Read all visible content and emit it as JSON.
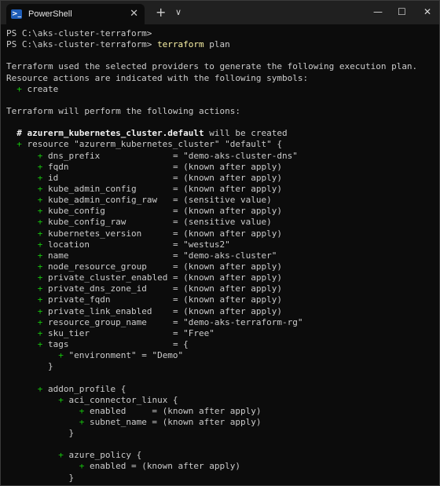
{
  "window": {
    "tab_title": "PowerShell",
    "tab_icon": "powershell-icon",
    "close_tab_glyph": "✕",
    "new_tab_glyph": "+",
    "dropdown_glyph": "∨",
    "minimize_glyph": "—",
    "maximize_glyph": "☐",
    "close_glyph": "✕"
  },
  "colors": {
    "background": "#0c0c0c",
    "text": "#cccccc",
    "command": "#f9f1a5",
    "plus": "#16c60c",
    "bold": "#f2f2f2"
  },
  "terminal": {
    "lines": [
      [
        {
          "t": "PS C:\\aks-cluster-terraform>"
        }
      ],
      [
        {
          "t": "PS C:\\aks-cluster-terraform> "
        },
        {
          "t": "terraform",
          "c": "cmd"
        },
        {
          "t": " plan"
        }
      ],
      [],
      [
        {
          "t": "Terraform used the selected providers to generate the following execution plan."
        }
      ],
      [
        {
          "t": "Resource actions are indicated with the following symbols:"
        }
      ],
      [
        {
          "t": "  "
        },
        {
          "t": "+",
          "c": "plus"
        },
        {
          "t": " create"
        }
      ],
      [],
      [
        {
          "t": "Terraform will perform the following actions:"
        }
      ],
      [],
      [
        {
          "t": "  "
        },
        {
          "t": "# azurerm_kubernetes_cluster.default",
          "c": "bold"
        },
        {
          "t": " will be created"
        }
      ],
      [
        {
          "t": "  "
        },
        {
          "t": "+",
          "c": "plus"
        },
        {
          "t": " resource \"azurerm_kubernetes_cluster\" \"default\" {"
        }
      ],
      [
        {
          "t": "      "
        },
        {
          "t": "+",
          "c": "plus"
        },
        {
          "t": " dns_prefix              = \"demo-aks-cluster-dns\""
        }
      ],
      [
        {
          "t": "      "
        },
        {
          "t": "+",
          "c": "plus"
        },
        {
          "t": " fqdn                    = (known after apply)"
        }
      ],
      [
        {
          "t": "      "
        },
        {
          "t": "+",
          "c": "plus"
        },
        {
          "t": " id                      = (known after apply)"
        }
      ],
      [
        {
          "t": "      "
        },
        {
          "t": "+",
          "c": "plus"
        },
        {
          "t": " kube_admin_config       = (known after apply)"
        }
      ],
      [
        {
          "t": "      "
        },
        {
          "t": "+",
          "c": "plus"
        },
        {
          "t": " kube_admin_config_raw   = (sensitive value)"
        }
      ],
      [
        {
          "t": "      "
        },
        {
          "t": "+",
          "c": "plus"
        },
        {
          "t": " kube_config             = (known after apply)"
        }
      ],
      [
        {
          "t": "      "
        },
        {
          "t": "+",
          "c": "plus"
        },
        {
          "t": " kube_config_raw         = (sensitive value)"
        }
      ],
      [
        {
          "t": "      "
        },
        {
          "t": "+",
          "c": "plus"
        },
        {
          "t": " kubernetes_version      = (known after apply)"
        }
      ],
      [
        {
          "t": "      "
        },
        {
          "t": "+",
          "c": "plus"
        },
        {
          "t": " location                = \"westus2\""
        }
      ],
      [
        {
          "t": "      "
        },
        {
          "t": "+",
          "c": "plus"
        },
        {
          "t": " name                    = \"demo-aks-cluster\""
        }
      ],
      [
        {
          "t": "      "
        },
        {
          "t": "+",
          "c": "plus"
        },
        {
          "t": " node_resource_group     = (known after apply)"
        }
      ],
      [
        {
          "t": "      "
        },
        {
          "t": "+",
          "c": "plus"
        },
        {
          "t": " private_cluster_enabled = (known after apply)"
        }
      ],
      [
        {
          "t": "      "
        },
        {
          "t": "+",
          "c": "plus"
        },
        {
          "t": " private_dns_zone_id     = (known after apply)"
        }
      ],
      [
        {
          "t": "      "
        },
        {
          "t": "+",
          "c": "plus"
        },
        {
          "t": " private_fqdn            = (known after apply)"
        }
      ],
      [
        {
          "t": "      "
        },
        {
          "t": "+",
          "c": "plus"
        },
        {
          "t": " private_link_enabled    = (known after apply)"
        }
      ],
      [
        {
          "t": "      "
        },
        {
          "t": "+",
          "c": "plus"
        },
        {
          "t": " resource_group_name     = \"demo-aks-terraform-rg\""
        }
      ],
      [
        {
          "t": "      "
        },
        {
          "t": "+",
          "c": "plus"
        },
        {
          "t": " sku_tier                = \"Free\""
        }
      ],
      [
        {
          "t": "      "
        },
        {
          "t": "+",
          "c": "plus"
        },
        {
          "t": " tags                    = {"
        }
      ],
      [
        {
          "t": "          "
        },
        {
          "t": "+",
          "c": "plus"
        },
        {
          "t": " \"environment\" = \"Demo\""
        }
      ],
      [
        {
          "t": "        }"
        }
      ],
      [],
      [
        {
          "t": "      "
        },
        {
          "t": "+",
          "c": "plus"
        },
        {
          "t": " addon_profile {"
        }
      ],
      [
        {
          "t": "          "
        },
        {
          "t": "+",
          "c": "plus"
        },
        {
          "t": " aci_connector_linux {"
        }
      ],
      [
        {
          "t": "              "
        },
        {
          "t": "+",
          "c": "plus"
        },
        {
          "t": " enabled     = (known after apply)"
        }
      ],
      [
        {
          "t": "              "
        },
        {
          "t": "+",
          "c": "plus"
        },
        {
          "t": " subnet_name = (known after apply)"
        }
      ],
      [
        {
          "t": "            }"
        }
      ],
      [],
      [
        {
          "t": "          "
        },
        {
          "t": "+",
          "c": "plus"
        },
        {
          "t": " azure_policy {"
        }
      ],
      [
        {
          "t": "              "
        },
        {
          "t": "+",
          "c": "plus"
        },
        {
          "t": " enabled = (known after apply)"
        }
      ],
      [
        {
          "t": "            }"
        }
      ]
    ]
  }
}
